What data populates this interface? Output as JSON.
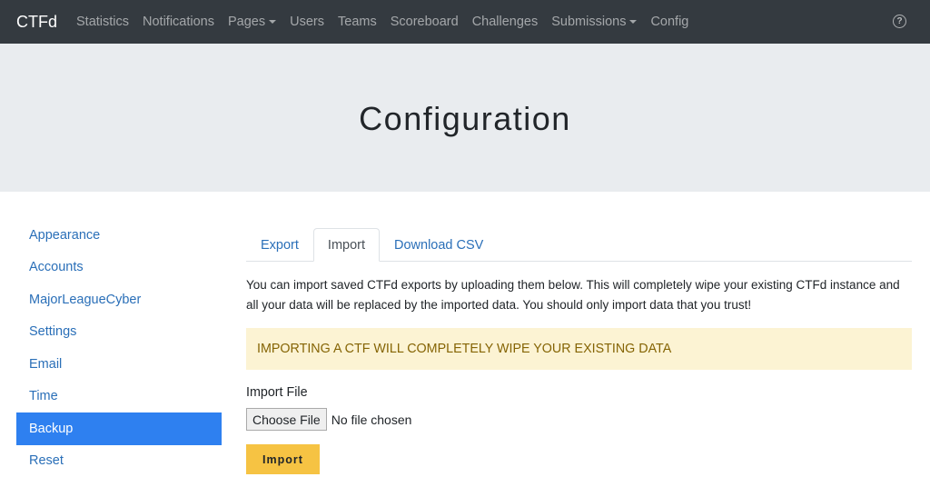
{
  "navbar": {
    "brand": "CTFd",
    "items": [
      {
        "label": "Statistics",
        "dropdown": false
      },
      {
        "label": "Notifications",
        "dropdown": false
      },
      {
        "label": "Pages",
        "dropdown": true
      },
      {
        "label": "Users",
        "dropdown": false
      },
      {
        "label": "Teams",
        "dropdown": false
      },
      {
        "label": "Scoreboard",
        "dropdown": false
      },
      {
        "label": "Challenges",
        "dropdown": false
      },
      {
        "label": "Submissions",
        "dropdown": true
      },
      {
        "label": "Config",
        "dropdown": false
      }
    ],
    "help_icon": "question-circle-icon",
    "help_glyph": "?"
  },
  "header": {
    "title": "Configuration"
  },
  "sidebar": {
    "items": [
      {
        "label": "Appearance"
      },
      {
        "label": "Accounts"
      },
      {
        "label": "MajorLeagueCyber"
      },
      {
        "label": "Settings"
      },
      {
        "label": "Email"
      },
      {
        "label": "Time"
      },
      {
        "label": "Backup",
        "active": true
      },
      {
        "label": "Reset"
      }
    ]
  },
  "main": {
    "tabs": [
      {
        "label": "Export"
      },
      {
        "label": "Import",
        "active": true
      },
      {
        "label": "Download CSV"
      }
    ],
    "description": "You can import saved CTFd exports by uploading them below. This will completely wipe your existing CTFd instance and all your data will be replaced by the imported data. You should only import data that you trust!",
    "alert": "IMPORTING A CTF WILL COMPLETELY WIPE YOUR EXISTING DATA",
    "import_file_label": "Import File",
    "choose_file_label": "Choose File",
    "file_status": "No file chosen",
    "import_button": "Import"
  },
  "colors": {
    "navbar_bg": "#343a40",
    "link": "#2a6fb8",
    "active_sidebar": "#2e80f0",
    "alert_bg": "#fcf3d3",
    "alert_text": "#856404",
    "import_button": "#f6c343"
  }
}
